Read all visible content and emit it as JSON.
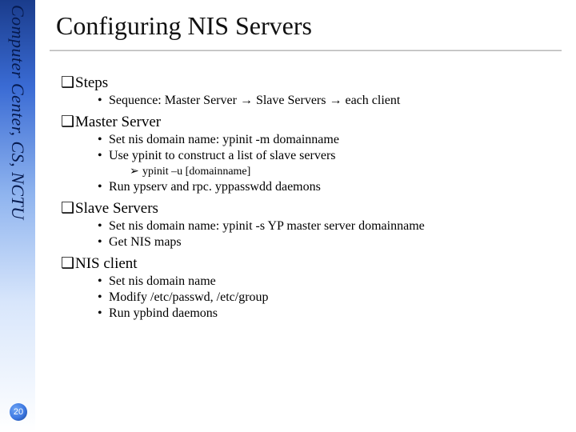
{
  "rail": {
    "org": "Computer Center, CS, NCTU"
  },
  "page": {
    "number": "20"
  },
  "title": "Configuring NIS Servers",
  "marks": {
    "l1": "❑",
    "l2": "•",
    "l3": "➢",
    "arrow": "→"
  },
  "sections": {
    "steps": {
      "heading": "Steps",
      "seq_prefix": "Sequence: Master Server ",
      "seq_mid": " Slave Servers ",
      "seq_tail": " each client"
    },
    "master": {
      "heading": "Master Server",
      "b1": "Set nis domain name: ypinit -m domainname",
      "b2": "Use ypinit to construct a list of slave servers",
      "s1": "ypinit –u [domainname]",
      "b3": "Run ypserv and rpc. yppasswdd daemons"
    },
    "slave": {
      "heading": "Slave Servers",
      "b1": "Set nis domain name: ypinit -s YP master server domainname",
      "b2": "Get NIS maps"
    },
    "client": {
      "heading": "NIS client",
      "b1": "Set nis domain name",
      "b2": "Modify /etc/passwd, /etc/group",
      "b3": "Run ypbind daemons"
    }
  }
}
